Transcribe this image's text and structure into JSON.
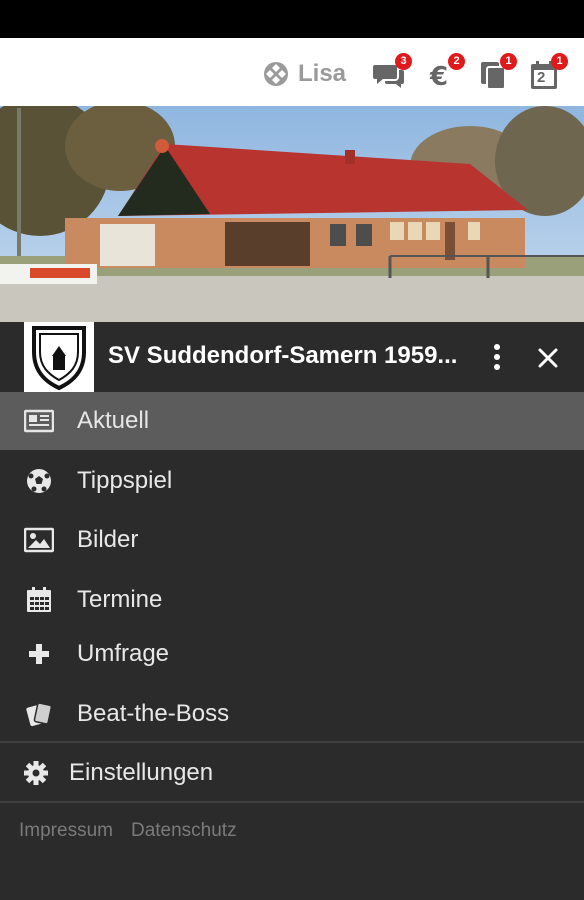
{
  "topbar": {
    "user_name": "Lisa",
    "badges": {
      "messages": "3",
      "finance": "2",
      "documents": "1",
      "calendar": "1"
    },
    "calendar_day": "2"
  },
  "header": {
    "club_name": "SV Suddendorf-Samern 1959..."
  },
  "menu": {
    "items": [
      {
        "label": "Aktuell",
        "icon": "newspaper-icon"
      },
      {
        "label": "Tippspiel",
        "icon": "soccer-ball-icon"
      },
      {
        "label": "Bilder",
        "icon": "image-icon"
      },
      {
        "label": "Termine",
        "icon": "calendar-icon"
      },
      {
        "label": "Umfrage",
        "icon": "plus-icon"
      },
      {
        "label": "Beat-the-Boss",
        "icon": "cards-icon"
      }
    ],
    "settings_label": "Einstellungen"
  },
  "footer": {
    "impressum": "Impressum",
    "datenschutz": "Datenschutz"
  },
  "colors": {
    "badge": "#e01a1a",
    "drawer_bg": "#2b2b2b",
    "active_bg": "#5c5c5c"
  }
}
